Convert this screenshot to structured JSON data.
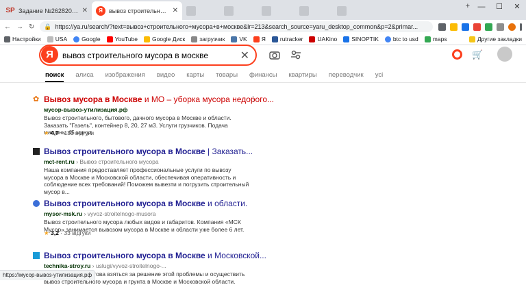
{
  "tabs": [
    {
      "fav": "SP",
      "title": "Задание №2628201 - просмотр з",
      "active": false
    },
    {
      "fav": "Я",
      "title": "вывоз строительного мусора в м",
      "active": true
    },
    {
      "fav": "",
      "title": "",
      "active": false
    },
    {
      "fav": "",
      "title": "",
      "active": false
    },
    {
      "fav": "",
      "title": "",
      "active": false
    },
    {
      "fav": "",
      "title": "",
      "active": false
    },
    {
      "fav": "",
      "title": "",
      "active": false
    }
  ],
  "address": {
    "url": "https://ya.ru/search/?text=вывоз+строительного+мусора+в+москве&lr=213&search_source=yaru_desktop_common&p=2&primar..."
  },
  "bookmarks": [
    "Настройки",
    "USA",
    "Google",
    "YouTube",
    "Google Диск",
    "загрузчик",
    "VK",
    "Я",
    "rutracker",
    "UAKino",
    "SINOPTIK",
    "btc to usd",
    "maps"
  ],
  "bookmarks_other": "Другие закладки",
  "search": {
    "logo": "Я",
    "query": "вывоз строительного мусора в москве",
    "clear": "✕"
  },
  "nav": [
    "поиск",
    "алиса",
    "изображения",
    "видео",
    "карты",
    "товары",
    "финансы",
    "квартиры",
    "переводчик",
    "усі"
  ],
  "results": [
    {
      "title_a": "Вывоз мусора в Москве",
      "title_b": " и МО – уборка мусора недорого...",
      "url": "мусор-вывоз-утилизация.рф",
      "path": "",
      "snippet": "Вывоз строительного, бытового, дачного мусора в Москве и области. Заказать \"Газель\", контейнер 8, 20, 27 м3. Услуги грузчиков. Подача машины 45 минут.",
      "rating": "4,7",
      "reviews": " · 133 відгуки"
    },
    {
      "title_a": "Вывоз строительного мусора в Москве",
      "title_b": " | Заказать...",
      "url": "mct-rent.ru",
      "path": " › Вывоз строительного мусора",
      "snippet": "Наша компания предоставляет профессиональные услуги по вывозу мусора в Москве и Московской области, обеспечивая оперативность и соблюдение всех требований! Поможем вывезти и погрузить строительный мусор в...",
      "rating": "",
      "reviews": ""
    },
    {
      "title_a": "Вывоз строительного мусора в Москве",
      "title_b": " и области.",
      "url": "mysor-msk.ru",
      "path": " › vyvoz-stroitelnogo-musora",
      "snippet": "Вывоз строительного мусора любых видов и габаритов. Компания «МСК Мусор» занимается вывозом мусора в Москве и области уже более 6 лет.",
      "rating": "3,2",
      "reviews": " · 33 відгуки"
    },
    {
      "title_a": "Вывоз строительного мусора в Москве",
      "title_b": " и Московской...",
      "url": "technika-stroy.ru",
      "path": " › uslugi/vyvoz-stroitelnogo-...",
      "snippet": "Наша компания готова взяться за решение этой проблемы и осуществить вывоз строительного мусора и грунта в Москве и Московской области.",
      "rating": "",
      "reviews": ""
    }
  ],
  "status": "https://мусор-вывоз-утилизация.рф",
  "colors": {
    "brand": "#fc3f1d",
    "link": "#1f1e91",
    "first_link": "#cc0000",
    "url": "#006000"
  }
}
